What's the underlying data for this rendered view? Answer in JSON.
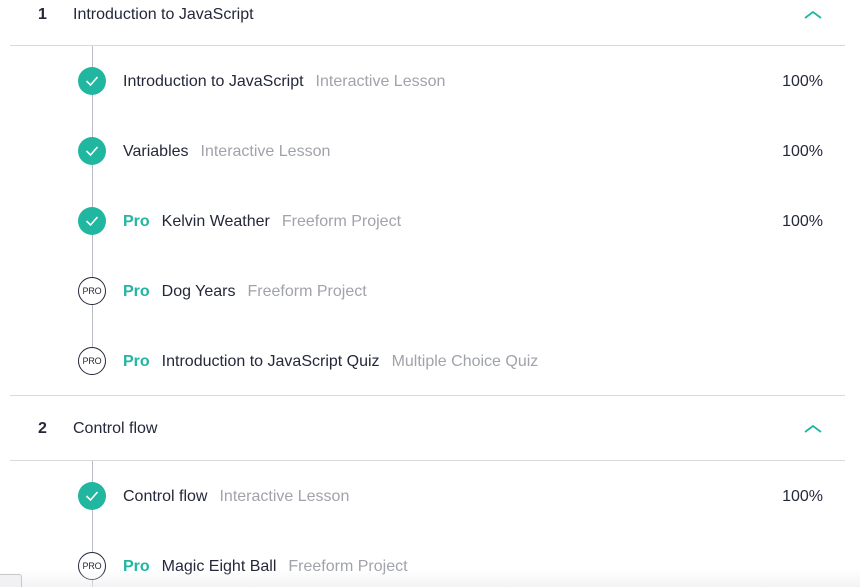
{
  "sections": [
    {
      "number": "1",
      "title": "Introduction to JavaScript",
      "expanded": true,
      "lessons": [
        {
          "status": "complete",
          "pro": false,
          "pro_label": "",
          "title": "Introduction to JavaScript",
          "type": "Interactive Lesson",
          "progress": "100%"
        },
        {
          "status": "complete",
          "pro": false,
          "pro_label": "",
          "title": "Variables",
          "type": "Interactive Lesson",
          "progress": "100%"
        },
        {
          "status": "complete",
          "pro": true,
          "pro_label": "Pro",
          "title": "Kelvin Weather",
          "type": "Freeform Project",
          "progress": "100%"
        },
        {
          "status": "locked",
          "status_icon_text": "PRO",
          "pro": true,
          "pro_label": "Pro",
          "title": "Dog Years",
          "type": "Freeform Project",
          "progress": ""
        },
        {
          "status": "locked",
          "status_icon_text": "PRO",
          "pro": true,
          "pro_label": "Pro",
          "title": "Introduction to JavaScript Quiz",
          "type": "Multiple Choice Quiz",
          "progress": ""
        }
      ]
    },
    {
      "number": "2",
      "title": "Control flow",
      "expanded": true,
      "lessons": [
        {
          "status": "complete",
          "pro": false,
          "pro_label": "",
          "title": "Control flow",
          "type": "Interactive Lesson",
          "progress": "100%"
        },
        {
          "status": "locked",
          "status_icon_text": "PRO",
          "pro": true,
          "pro_label": "Pro",
          "title": "Magic Eight Ball",
          "type": "Freeform Project",
          "progress": ""
        }
      ]
    }
  ],
  "colors": {
    "accent": "#21b6a0",
    "text": "#25283a",
    "muted": "#a1a3ab",
    "divider": "#d9d9dd"
  },
  "icons": {
    "complete": "checkmark-circle-icon",
    "locked": "pro-badge-icon",
    "collapse": "chevron-up-icon"
  }
}
